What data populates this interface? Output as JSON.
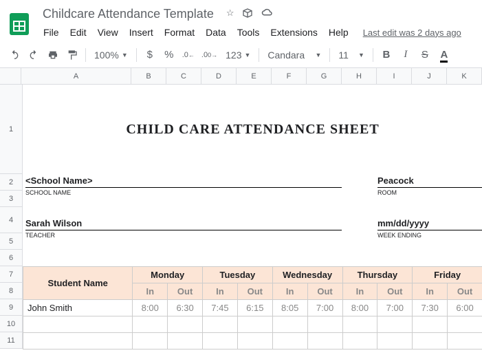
{
  "header": {
    "doc_title": "Childcare Attendance Template",
    "last_edit": "Last edit was 2 days ago"
  },
  "menu": {
    "file": "File",
    "edit": "Edit",
    "view": "View",
    "insert": "Insert",
    "format": "Format",
    "data": "Data",
    "tools": "Tools",
    "extensions": "Extensions",
    "help": "Help"
  },
  "toolbar": {
    "zoom": "100%",
    "currency": "$",
    "percent": "%",
    "dec_dec": ".0",
    "dec_inc": ".00",
    "more_formats": "123",
    "font": "Candara",
    "font_size": "11",
    "bold": "B",
    "italic": "I",
    "strike": "S",
    "textcolor": "A"
  },
  "columns": [
    "A",
    "B",
    "C",
    "D",
    "E",
    "F",
    "G",
    "H",
    "I",
    "J",
    "K"
  ],
  "rows": [
    "1",
    "2",
    "3",
    "4",
    "5",
    "6",
    "7",
    "8",
    "9",
    "10",
    "11"
  ],
  "sheet": {
    "title": "CHILD CARE ATTENDANCE SHEET",
    "school_name": "<School Name>",
    "school_label": "SCHOOL NAME",
    "room": "Peacock",
    "room_label": "ROOM",
    "teacher": "Sarah Wilson",
    "teacher_label": "TEACHER",
    "week_ending": "mm/dd/yyyy",
    "week_ending_label": "WEEK ENDING"
  },
  "table": {
    "student_header": "Student Name",
    "days": [
      "Monday",
      "Tuesday",
      "Wednesday",
      "Thursday",
      "Friday"
    ],
    "in": "In",
    "out": "Out",
    "rows": [
      {
        "name": "John Smith",
        "times": [
          "8:00",
          "6:30",
          "7:45",
          "6:15",
          "8:05",
          "7:00",
          "8:00",
          "7:00",
          "7:30",
          "6:00"
        ]
      }
    ]
  },
  "chart_data": {
    "type": "table",
    "title": "CHILD CARE ATTENDANCE SHEET",
    "columns": [
      "Student Name",
      "Mon In",
      "Mon Out",
      "Tue In",
      "Tue Out",
      "Wed In",
      "Wed Out",
      "Thu In",
      "Thu Out",
      "Fri In",
      "Fri Out"
    ],
    "rows": [
      [
        "John Smith",
        "8:00",
        "6:30",
        "7:45",
        "6:15",
        "8:05",
        "7:00",
        "8:00",
        "7:00",
        "7:30",
        "6:00"
      ]
    ]
  }
}
